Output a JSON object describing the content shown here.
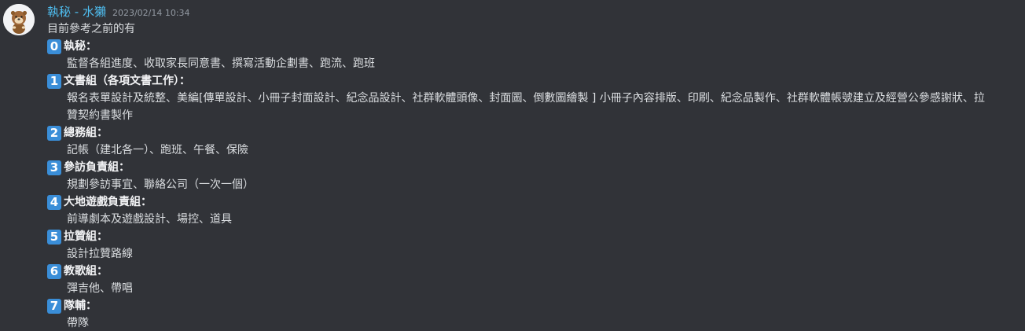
{
  "message": {
    "username": "執秘 - 水獺",
    "timestamp": "2023/02/14 10:34",
    "intro": "目前參考之前的有",
    "sections": [
      {
        "badge": "0",
        "title": "執秘：",
        "desc": "監督各組進度、收取家長同意書、撰寫活動企劃書、跑流、跑班"
      },
      {
        "badge": "1",
        "title": "文書組（各項文書工作）：",
        "desc": "報名表單設計及統整、美編[傳單設計、小冊子封面設計、紀念品設計、社群軟體頭像、封面圖、倒數圖繪製 ] 小冊子內容排版、印刷、紀念品製作、社群軟體帳號建立及經營公參感謝狀、拉贊契約書製作"
      },
      {
        "badge": "2",
        "title": "總務組：",
        "desc": "記帳（建北各一）、跑班、午餐、保險"
      },
      {
        "badge": "3",
        "title": "參訪負責組：",
        "desc": "規劃參訪事宜、聯絡公司（一次一個）"
      },
      {
        "badge": "4",
        "title": "大地遊戲負責組：",
        "desc": "前導劇本及遊戲設計、場控、道具"
      },
      {
        "badge": "5",
        "title": "拉贊組：",
        "desc": "設計拉贊路線"
      },
      {
        "badge": "6",
        "title": "教歌組：",
        "desc": "彈吉他、帶唱"
      },
      {
        "badge": "7",
        "title": "隊輔：",
        "desc": "帶隊"
      }
    ]
  },
  "colors": {
    "background": "#313338",
    "username": "#4fbef0",
    "badge": "#3a8ed8",
    "text": "#dbdee1"
  },
  "avatar_icon": "otter-avatar-icon"
}
